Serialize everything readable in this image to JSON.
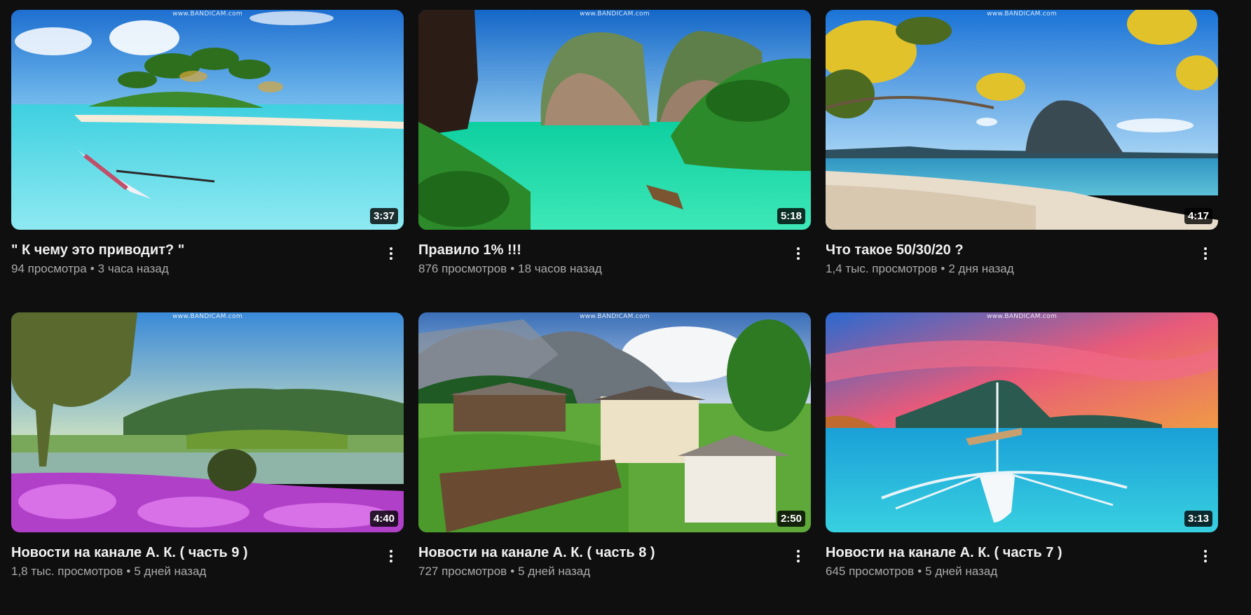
{
  "watermark": "www.BANDICAM.com",
  "videos": [
    {
      "title": "\" К чему это приводит? \"",
      "views": "94 просмотра",
      "age": "3 часа назад",
      "duration": "3:37"
    },
    {
      "title": "Правило 1% !!!",
      "views": "876 просмотров",
      "age": "18 часов назад",
      "duration": "5:18"
    },
    {
      "title": "Что такое 50/30/20 ?",
      "views": "1,4 тыс. просмотров",
      "age": "2 дня назад",
      "duration": "4:17"
    },
    {
      "title": "Новости на канале А. К.   ( часть 9 )",
      "views": "1,8 тыс. просмотров",
      "age": "5 дней назад",
      "duration": "4:40"
    },
    {
      "title": "Новости на канале А. К.  ( часть 8 )",
      "views": "727 просмотров",
      "age": "5 дней назад",
      "duration": "2:50"
    },
    {
      "title": "Новости на канале А. К. ( часть 7 )",
      "views": "645 просмотров",
      "age": "5 дней назад",
      "duration": "3:13"
    }
  ],
  "icons": {
    "more": "more-vert-icon"
  }
}
